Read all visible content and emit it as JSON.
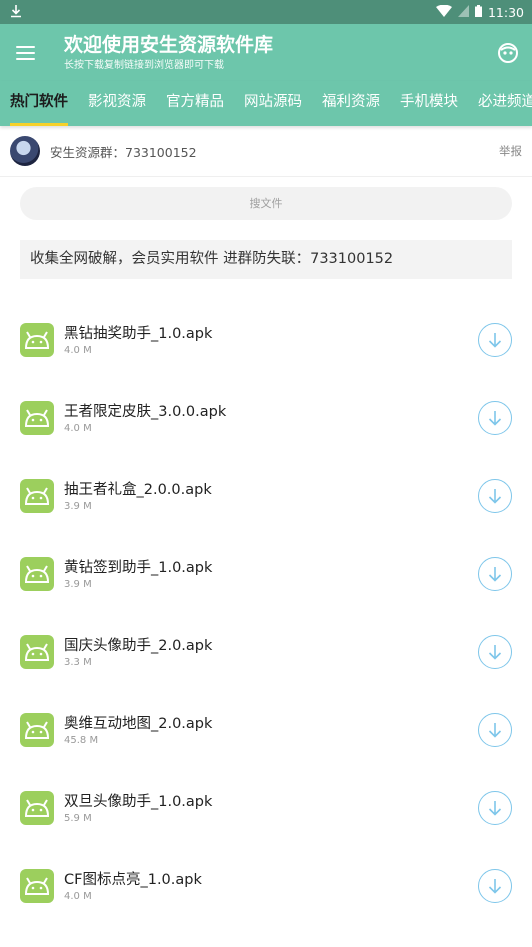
{
  "status_bar": {
    "time": "11:30",
    "download_icon": "download-arrow-icon",
    "wifi_icon": "wifi-icon",
    "signal_icon": "signal-icon",
    "battery_icon": "battery-icon"
  },
  "app_bar": {
    "title": "欢迎使用安生资源软件库",
    "subtitle": "长按下载复制链接到浏览器即可下载",
    "menu_icon": "hamburger-menu-icon",
    "right_icon": "robot-face-icon"
  },
  "tabs": [
    {
      "label": "热门软件",
      "active": true
    },
    {
      "label": "影视资源"
    },
    {
      "label": "官方精品"
    },
    {
      "label": "网站源码"
    },
    {
      "label": "福利资源"
    },
    {
      "label": "手机模块"
    },
    {
      "label": "必进频道"
    }
  ],
  "group": {
    "text": "安生资源群：733100152",
    "report": "举报"
  },
  "search": {
    "placeholder": "搜文件"
  },
  "notice": "收集全网破解，会员实用软件 进群防失联：733100152",
  "files": [
    {
      "name": "黑钻抽奖助手_1.0.apk",
      "size": "4.0 M"
    },
    {
      "name": "王者限定皮肤_3.0.0.apk",
      "size": "4.0 M"
    },
    {
      "name": "抽王者礼盒_2.0.0.apk",
      "size": "3.9 M"
    },
    {
      "name": "黄钻签到助手_1.0.apk",
      "size": "3.9 M"
    },
    {
      "name": "国庆头像助手_2.0.apk",
      "size": "3.3 M"
    },
    {
      "name": "奥维互动地图_2.0.apk",
      "size": "45.8 M"
    },
    {
      "name": "双旦头像助手_1.0.apk",
      "size": "5.9 M"
    },
    {
      "name": "CF图标点亮_1.0.apk",
      "size": "4.0 M"
    }
  ],
  "colors": {
    "status_bar": "#4e8f79",
    "primary": "#6dc6ab",
    "tab_indicator": "#f6d12a",
    "apk_icon": "#9ccf5d",
    "download_ring": "#7ec6ea"
  }
}
